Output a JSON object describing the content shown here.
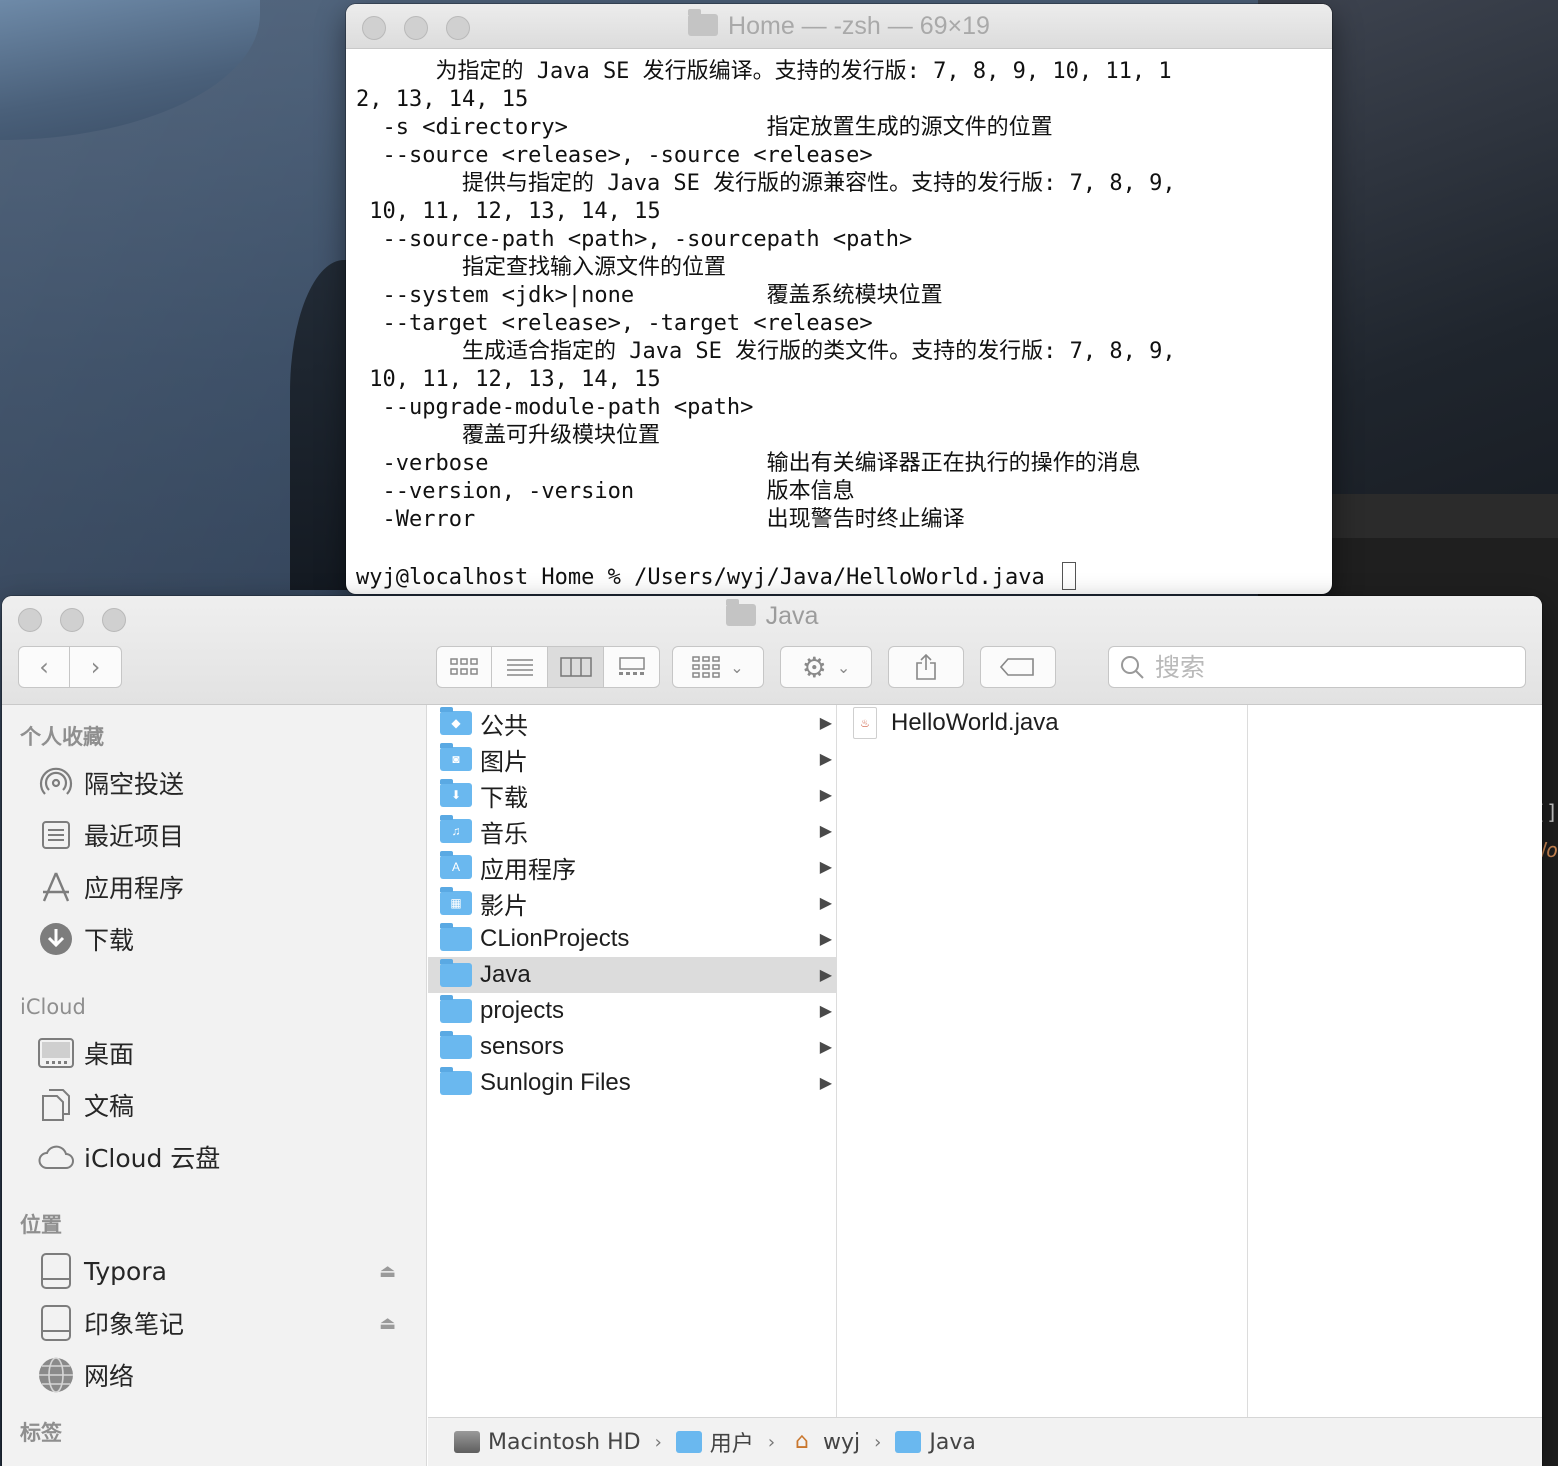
{
  "terminal": {
    "title": "Home — -zsh — 69×19",
    "lines": [
      "      为指定的 Java SE 发行版编译。支持的发行版: 7, 8, 9, 10, 11, 1",
      "2, 13, 14, 15",
      "  -s <directory>               指定放置生成的源文件的位置",
      "  --source <release>, -source <release>",
      "        提供与指定的 Java SE 发行版的源兼容性。支持的发行版: 7, 8, 9,",
      " 10, 11, 12, 13, 14, 15",
      "  --source-path <path>, -sourcepath <path>",
      "        指定查找输入源文件的位置",
      "  --system <jdk>|none          覆盖系统模块位置",
      "  --target <release>, -target <release>",
      "        生成适合指定的 Java SE 发行版的类文件。支持的发行版: 7, 8, 9,",
      " 10, 11, 12, 13, 14, 15",
      "  --upgrade-module-path <path>",
      "        覆盖可升级模块位置",
      "  -verbose                     输出有关编译器正在执行的操作的消息",
      "  --version, -version          版本信息",
      "  -Werror                      出现警告时终止编译",
      "",
      "wyj@localhost Home % /Users/wyj/Java/HelloWorld.java "
    ]
  },
  "finder": {
    "title": "Java",
    "search_placeholder": "搜索",
    "sidebar": {
      "favorites_header": "个人收藏",
      "favorites": [
        {
          "label": "隔空投送",
          "icon": "airdrop-icon"
        },
        {
          "label": "最近项目",
          "icon": "recents-icon"
        },
        {
          "label": "应用程序",
          "icon": "applications-icon"
        },
        {
          "label": "下载",
          "icon": "downloads-icon"
        }
      ],
      "icloud_header": "iCloud",
      "icloud": [
        {
          "label": "桌面",
          "icon": "desktop-icon"
        },
        {
          "label": "文稿",
          "icon": "documents-icon"
        },
        {
          "label": "iCloud 云盘",
          "icon": "cloud-icon"
        }
      ],
      "locations_header": "位置",
      "locations": [
        {
          "label": "Typora",
          "icon": "disk-icon",
          "eject": true
        },
        {
          "label": "印象笔记",
          "icon": "disk-icon",
          "eject": true
        },
        {
          "label": "网络",
          "icon": "network-icon",
          "eject": false
        }
      ],
      "tags_header": "标签"
    },
    "column1": [
      {
        "name": "公共",
        "glyph": "◆"
      },
      {
        "name": "图片",
        "glyph": "◙"
      },
      {
        "name": "下载",
        "glyph": "⬇"
      },
      {
        "name": "音乐",
        "glyph": "♫"
      },
      {
        "name": "应用程序",
        "glyph": "A"
      },
      {
        "name": "影片",
        "glyph": "▦"
      },
      {
        "name": "CLionProjects",
        "glyph": ""
      },
      {
        "name": "Java",
        "glyph": "",
        "selected": true
      },
      {
        "name": "projects",
        "glyph": ""
      },
      {
        "name": "sensors",
        "glyph": ""
      },
      {
        "name": "Sunlogin Files",
        "glyph": ""
      }
    ],
    "column2": [
      {
        "name": "HelloWorld.java"
      }
    ],
    "pathbar": [
      {
        "label": "Macintosh HD",
        "icon": "harddisk-icon"
      },
      {
        "label": "用户",
        "icon": "users-folder-icon"
      },
      {
        "label": "wyj",
        "icon": "home-icon"
      },
      {
        "label": "Java",
        "icon": "folder-icon"
      }
    ]
  },
  "edge": {
    "line1": "[]",
    "line2": "Wo"
  }
}
